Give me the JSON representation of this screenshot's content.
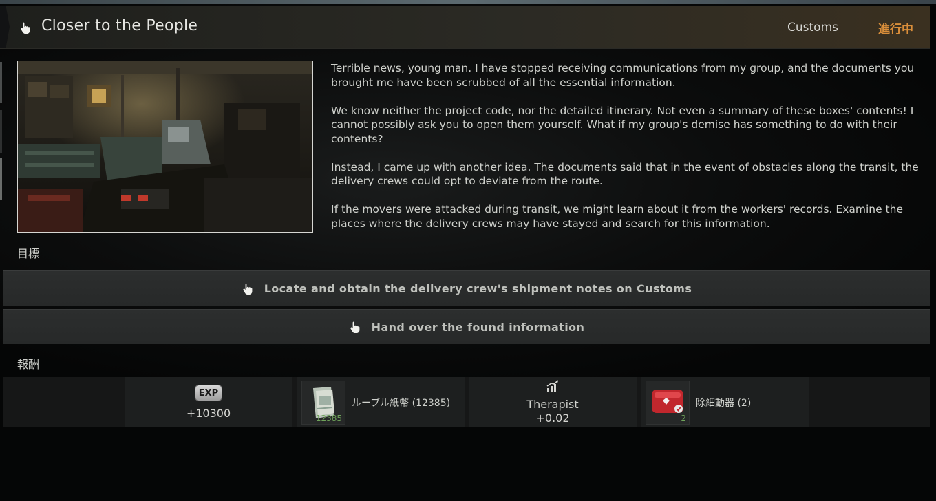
{
  "quest": {
    "title": "Closer to the People",
    "location": "Customs",
    "status": "進行中"
  },
  "description": {
    "paragraphs": [
      "Terrible news, young man. I have stopped receiving communications from my group, and the documents you brought me have been scrubbed of all the essential information.",
      "We know neither the project code, nor the detailed itinerary. Not even a summary of these boxes' contents! I cannot possibly ask you to open them yourself. What if my group's demise has something to do with their contents?",
      "Instead, I came up with another idea. The documents said that in the event of obstacles along the transit, the delivery crews could opt to deviate from the route.",
      "If the movers were attacked during transit, we might learn about it from the workers' records. Examine the places where the delivery crews may have stayed and search for this information."
    ]
  },
  "objectives": {
    "label": "目標",
    "items": [
      "Locate and obtain the delivery crew's shipment notes on Customs",
      "Hand over the found information"
    ]
  },
  "rewards": {
    "label": "報酬",
    "exp": {
      "badge": "EXP",
      "value": "+10300"
    },
    "roubles": {
      "label": "ルーブル紙幣 (12385)",
      "qty": "12385"
    },
    "reputation": {
      "trader": "Therapist",
      "value": "+0.02"
    },
    "item": {
      "label": "除細動器 (2)",
      "qty": "2"
    }
  },
  "colors": {
    "status": "#d98e3a",
    "qty": "#6fa35a",
    "objective_bg": "#2c2e2e"
  },
  "icons": {
    "title": "pointing-hand-icon",
    "objective": "pointing-hand-icon",
    "reputation": "reputation-chart-icon"
  }
}
